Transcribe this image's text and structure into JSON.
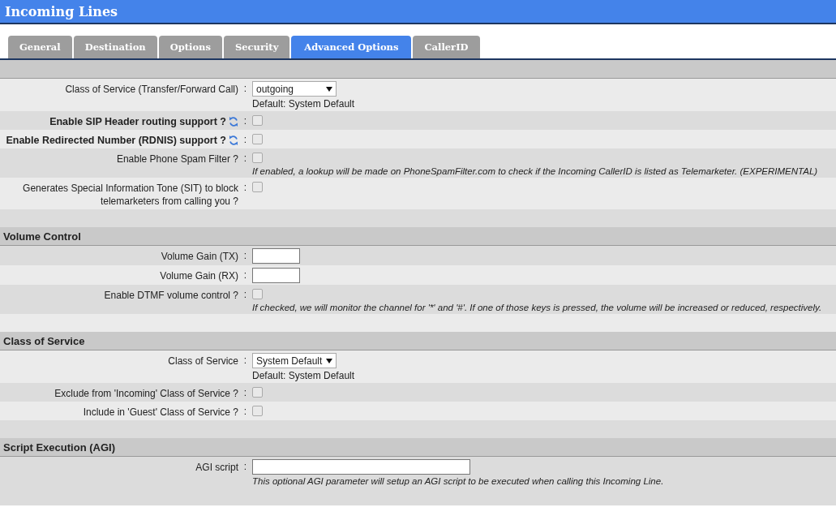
{
  "window": {
    "title": "Incoming Lines"
  },
  "tabs": [
    {
      "label": "General",
      "selected": false
    },
    {
      "label": "Destination",
      "selected": false
    },
    {
      "label": "Options",
      "selected": false
    },
    {
      "label": "Security",
      "selected": false
    },
    {
      "label": "Advanced Options",
      "selected": true
    },
    {
      "label": "CallerID",
      "selected": false
    }
  ],
  "sections": [
    {
      "rows": [
        {
          "kind": "select",
          "label": "Class of Service (Transfer/Forward Call)",
          "separator": ":",
          "value": "outgoing",
          "note": "Default: System Default"
        },
        {
          "kind": "checkbox",
          "label": "Enable SIP Header routing support ?",
          "bold": true,
          "sync_icon": true,
          "separator": ":",
          "checked": false
        },
        {
          "kind": "checkbox",
          "label": "Enable Redirected Number (RDNIS) support ?",
          "bold": true,
          "sync_icon": true,
          "separator": ":",
          "checked": false
        },
        {
          "kind": "checkbox",
          "label": "Enable Phone Spam Filter ?",
          "separator": ":",
          "checked": false,
          "help": "If enabled, a lookup will be made on PhoneSpamFilter.com to check if the Incoming CallerID is listed as Telemarketer. (EXPERIMENTAL)"
        },
        {
          "kind": "checkbox",
          "label": "Generates Special Information Tone (SIT) to block telemarketers from calling you ?",
          "separator": ":",
          "checked": false
        }
      ]
    },
    {
      "title": "Volume Control",
      "rows": [
        {
          "kind": "short_text",
          "label": "Volume Gain (TX)",
          "separator": ":"
        },
        {
          "kind": "short_text",
          "label": "Volume Gain (RX)",
          "separator": ":"
        },
        {
          "kind": "checkbox",
          "label": "Enable DTMF volume control ?",
          "separator": ":",
          "checked": false,
          "help": "If checked, we will monitor the channel for '*' and '#'. If one of those keys is pressed, the volume will be increased or reduced, respectively."
        }
      ]
    },
    {
      "title": "Class of Service",
      "rows": [
        {
          "kind": "select",
          "label": "Class of Service",
          "separator": ":",
          "value": "System Default",
          "note": "Default: System Default"
        },
        {
          "kind": "checkbox",
          "label": "Exclude from 'Incoming' Class of Service ?",
          "separator": ":",
          "checked": false
        },
        {
          "kind": "checkbox",
          "label": "Include in 'Guest' Class of Service ?",
          "separator": ":",
          "checked": false
        }
      ]
    },
    {
      "title": "Script Execution (AGI)",
      "rows": [
        {
          "kind": "long_text",
          "label": "AGI script",
          "separator": ":",
          "help": "This optional AGI parameter will setup an AGI script to be executed when calling this Incoming Line."
        }
      ]
    }
  ]
}
